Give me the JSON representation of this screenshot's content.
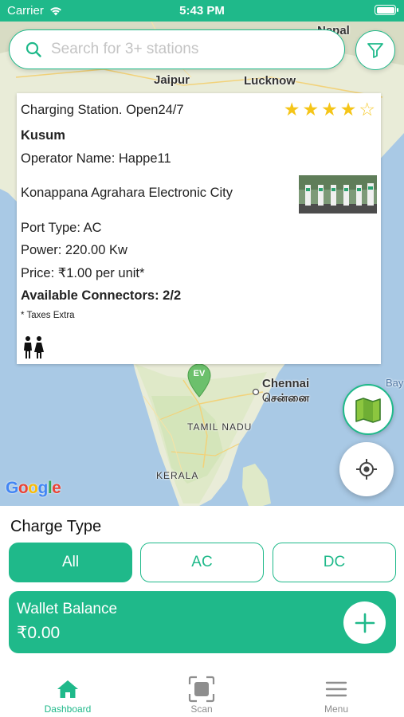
{
  "status_bar": {
    "carrier": "Carrier",
    "time": "5:43 PM"
  },
  "search": {
    "placeholder": "Search for 3+ stations",
    "value": ""
  },
  "map": {
    "labels": {
      "nepal": "Nepal",
      "jaipur": "Jaipur",
      "lucknow": "Lucknow",
      "chennai": "Chennai",
      "chennai_tamil": "சென்னை",
      "tamil_nadu": "TAMIL NADU",
      "kerala": "KERALA",
      "bay": "Bay"
    },
    "marker_label": "EV",
    "attribution": [
      "G",
      "o",
      "o",
      "g",
      "l",
      "e"
    ]
  },
  "station": {
    "title": "Charging Station. Open24/7",
    "rating": 4,
    "rating_max": 5,
    "name": "Kusum",
    "operator": "Operator Name:  Happe11",
    "address": "Konappana Agrahara Electronic City",
    "port_type": "Port Type: AC",
    "power": "Power: 220.00 Kw",
    "price": "Price:  ₹1.00 per unit*",
    "connectors": "Available Connectors: 2/2",
    "taxes_note": "* Taxes Extra"
  },
  "charge_type": {
    "heading": "Charge Type",
    "options": [
      {
        "label": "All",
        "active": true
      },
      {
        "label": "AC",
        "active": false
      },
      {
        "label": "DC",
        "active": false
      }
    ]
  },
  "wallet": {
    "label": "Wallet Balance",
    "amount": "₹0.00"
  },
  "tabbar": {
    "items": [
      {
        "label": "Dashboard",
        "icon": "home-icon",
        "active": true
      },
      {
        "label": "Scan",
        "icon": "scan-icon",
        "active": false
      },
      {
        "label": "Menu",
        "icon": "menu-icon",
        "active": false
      }
    ]
  },
  "colors": {
    "accent": "#1fb98a",
    "star": "#f5c518",
    "map_water": "#a9c9e5",
    "map_land": "#e9ecd8"
  }
}
